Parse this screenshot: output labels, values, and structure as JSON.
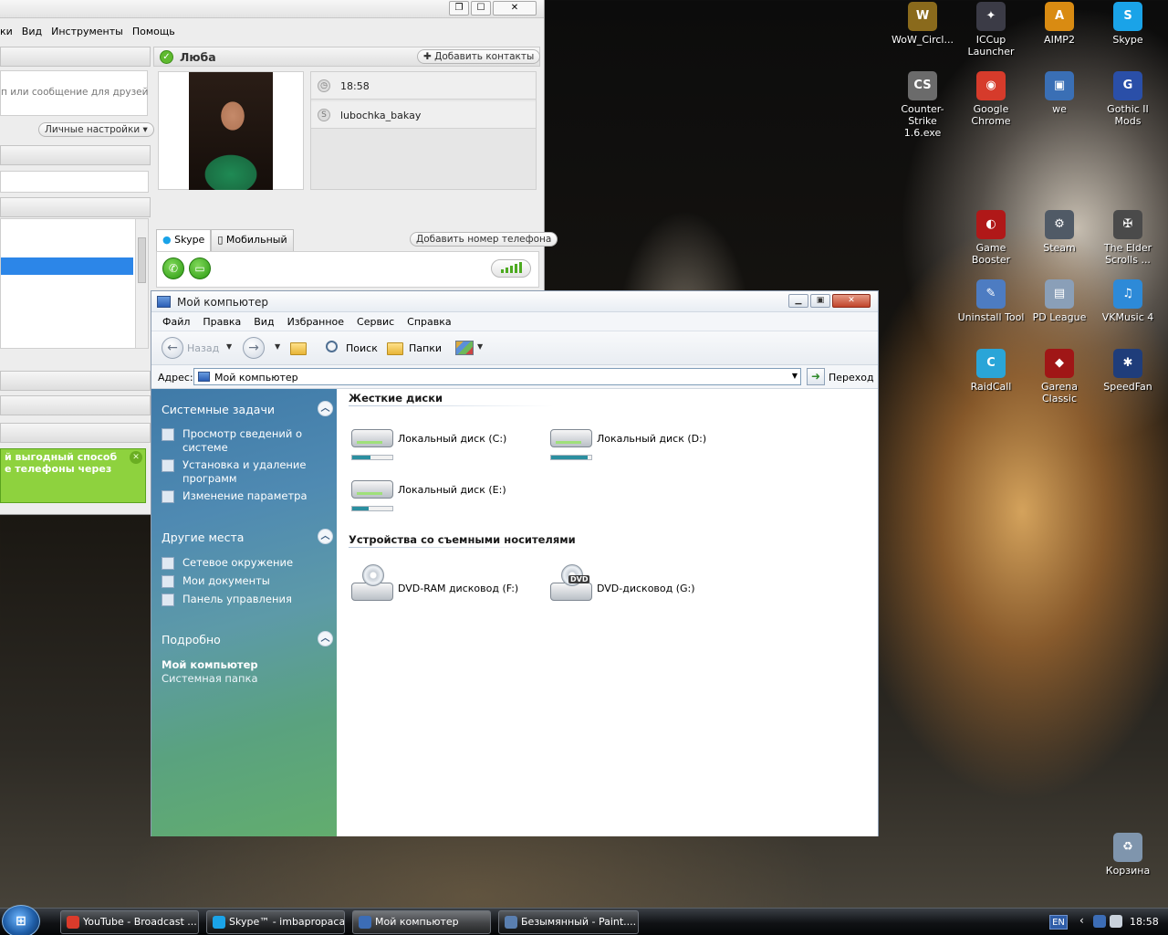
{
  "skype": {
    "menu": [
      "ки",
      "Вид",
      "Инструменты",
      "Помощь"
    ],
    "mood_placeholder_frag": "п или сообщение для друзей",
    "personal_settings": "Личные настройки",
    "promo": "й выгодный способ\nе телефоны через",
    "contact": {
      "name": "Люба",
      "add_contacts": "Добавить контакты",
      "time": "18:58",
      "skype_name": "lubochka_bakay"
    },
    "tabs": [
      "Skype",
      "Мобильный"
    ],
    "add_phone": "Добавить номер телефона"
  },
  "explorer": {
    "title": "Мой компьютер",
    "menu": [
      "Файл",
      "Правка",
      "Вид",
      "Избранное",
      "Сервис",
      "Справка"
    ],
    "toolbar": {
      "back": "Назад",
      "search": "Поиск",
      "folders": "Папки"
    },
    "address": {
      "label": "Адрес:",
      "value": "Мой компьютер",
      "go": "Переход"
    },
    "sidebar": {
      "system_tasks": {
        "title": "Системные задачи",
        "items": [
          "Просмотр сведений о системе",
          "Установка и удаление программ",
          "Изменение параметра"
        ]
      },
      "other_places": {
        "title": "Другие места",
        "items": [
          "Сетевое окружение",
          "Мои документы",
          "Панель управления"
        ]
      },
      "details": {
        "title": "Подробно",
        "name": "Мой компьютер",
        "subtitle": "Системная папка"
      }
    },
    "groups": {
      "hard_drives": "Жесткие диски",
      "removable": "Устройства со съемными носителями"
    },
    "drives": [
      {
        "name": "Локальный диск (C:)",
        "used": 0.45
      },
      {
        "name": "Локальный диск (D:)",
        "used": 0.92
      },
      {
        "name": "Локальный диск (E:)",
        "used": 0.4
      }
    ],
    "removable": [
      {
        "name": "DVD-RAM дисковод (F:)"
      },
      {
        "name": "DVD-дисковод (G:)",
        "tag": "DVD"
      }
    ]
  },
  "desktop_icons": [
    {
      "label": "WoW_Circl...",
      "color": "#8a6a1c",
      "glyph": "W"
    },
    {
      "label": "ICCup\nLauncher",
      "color": "#3b3b46",
      "glyph": "✦"
    },
    {
      "label": "AIMP2",
      "color": "#d98b12",
      "glyph": "A"
    },
    {
      "label": "Skype",
      "color": "#1aa3e8",
      "glyph": "S"
    },
    {
      "label": "Counter-Strike\n1.6.exe",
      "color": "#6b6b6b",
      "glyph": "CS"
    },
    {
      "label": "Google\nChrome",
      "color": "#d63b2b",
      "glyph": "◉"
    },
    {
      "label": "we",
      "color": "#3a6fb5",
      "glyph": "▣"
    },
    {
      "label": "Gothic II Mods",
      "color": "#2a4fa8",
      "glyph": "G"
    },
    {
      "label": "Game Booster",
      "color": "#b01818",
      "glyph": "◐"
    },
    {
      "label": "Steam",
      "color": "#505a66",
      "glyph": "⚙"
    },
    {
      "label": "The Elder\nScrolls ...",
      "color": "#4a4a4a",
      "glyph": "✠"
    },
    {
      "label": "Uninstall Tool",
      "color": "#4d7cc2",
      "glyph": "✎"
    },
    {
      "label": "PD League",
      "color": "#8a9fb8",
      "glyph": "▤"
    },
    {
      "label": "VKMusic 4",
      "color": "#2d8ad8",
      "glyph": "♫"
    },
    {
      "label": "RaidCall",
      "color": "#2aa5d8",
      "glyph": "C"
    },
    {
      "label": "Garena Classic",
      "color": "#a01616",
      "glyph": "◆"
    },
    {
      "label": "SpeedFan",
      "color": "#1f3d7a",
      "glyph": "✱"
    },
    {
      "label": "Корзина",
      "color": "#7f95ad",
      "glyph": "♻"
    }
  ],
  "taskbar": {
    "tasks": [
      {
        "label": "YouTube - Broadcast ...",
        "color": "#db3b2b"
      },
      {
        "label": "Skype™ - imbapropacan",
        "color": "#1aa3e8"
      },
      {
        "label": "Мой компьютер",
        "color": "#3c6db6"
      },
      {
        "label": "Безымянный - Paint....",
        "color": "#5a7fb0"
      }
    ],
    "lang": "EN",
    "clock": "18:58"
  }
}
